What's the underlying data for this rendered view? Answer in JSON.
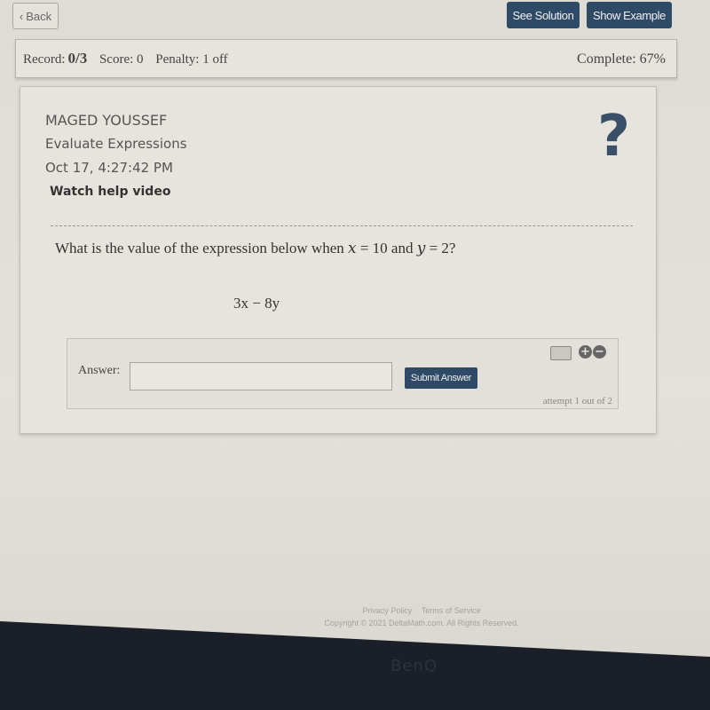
{
  "header": {
    "back_label": "Back",
    "see_solution_label": "See Solution",
    "show_example_label": "Show Example"
  },
  "record_bar": {
    "record_label": "Record:",
    "record_value": "0/3",
    "score": "Score: 0",
    "penalty": "Penalty: 1 off",
    "complete": "Complete: 67%"
  },
  "problem": {
    "student_name": "MAGED YOUSSEF",
    "topic": "Evaluate Expressions",
    "timestamp": "Oct 17, 4:27:42 PM",
    "help_link": "Watch help video",
    "help_icon": "?",
    "question_prefix": "What is the value of the expression below when ",
    "var_x": "x",
    "eq_x": " = 10 and ",
    "var_y": "y",
    "eq_y": " = 2?",
    "expression": "3x − 8y"
  },
  "answer": {
    "label": "Answer:",
    "value": "",
    "placeholder": "",
    "submit_label": "Submit Answer",
    "attempt_text": "attempt 1 out of 2",
    "icons": [
      "keyboard-icon",
      "plus-circle-icon",
      "minus-circle-icon"
    ]
  },
  "footer": {
    "privacy": "Privacy Policy",
    "terms": "Terms of Service",
    "copyright": "Copyright © 2021 DeltaMath.com. All Rights Reserved."
  },
  "monitor": {
    "brand": "BenQ"
  },
  "colors": {
    "accent": "#2f4a66",
    "background": "#e2e0d9"
  }
}
